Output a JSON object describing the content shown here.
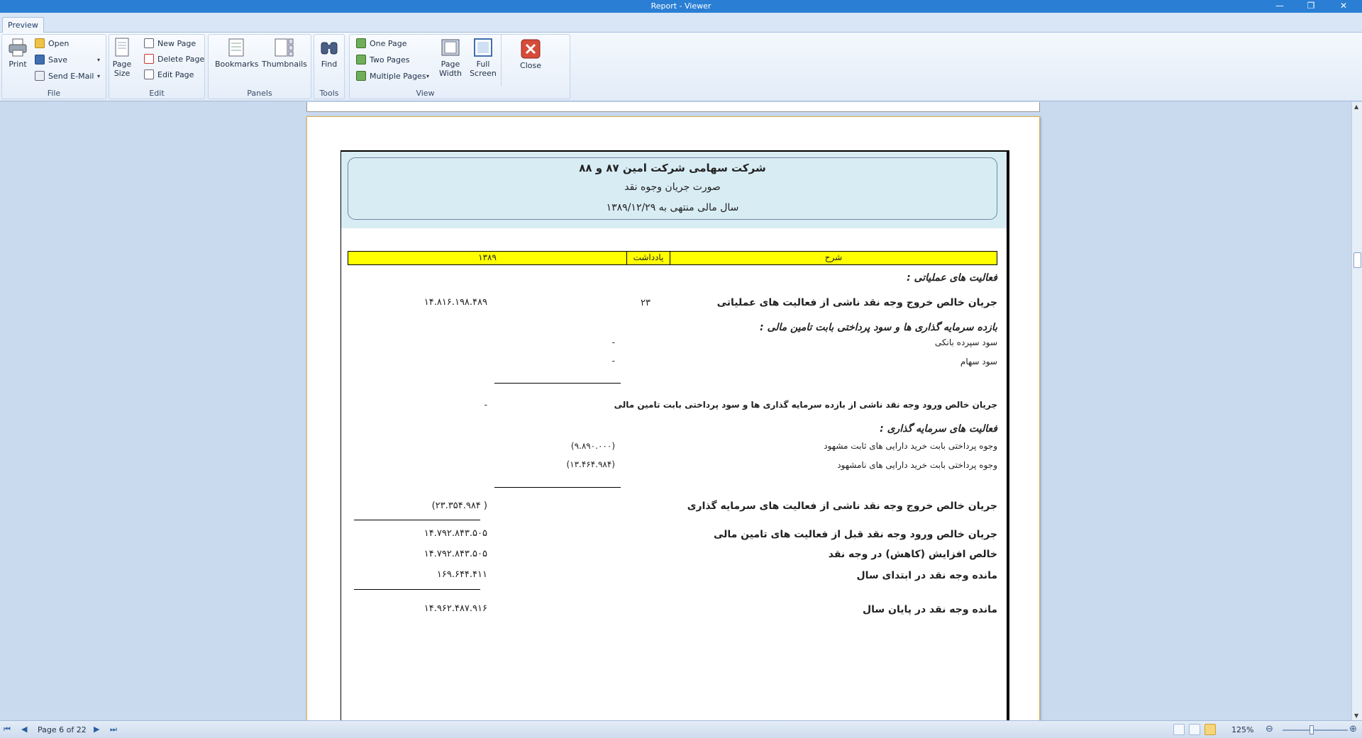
{
  "window": {
    "title": "Report - Viewer",
    "min_glyph": "—",
    "max_glyph": "❐",
    "close_glyph": "✕"
  },
  "tabs": [
    {
      "label": "Preview"
    }
  ],
  "ribbon": {
    "file": {
      "label": "File",
      "print": "Print",
      "open": "Open",
      "save": "Save",
      "send_email": "Send E-Mail"
    },
    "edit": {
      "label": "Edit",
      "page_size_1": "Page",
      "page_size_2": "Size",
      "new_page": "New Page",
      "delete_page": "Delete Page",
      "edit_page": "Edit Page"
    },
    "panels": {
      "label": "Panels",
      "bookmarks": "Bookmarks",
      "thumbnails": "Thumbnails"
    },
    "tools": {
      "label": "Tools",
      "find": "Find"
    },
    "view": {
      "label": "View",
      "one_page": "One Page",
      "two_pages": "Two Pages",
      "multiple_pages": "Multiple Pages",
      "page_width_1": "Page",
      "page_width_2": "Width",
      "full_screen_1": "Full",
      "full_screen_2": "Screen",
      "close": "Close"
    },
    "dropdown_glyph": "▾"
  },
  "report": {
    "company": "شرکت سهامی شرکت امین ۸۷ و ۸۸",
    "statement": "صورت جریان وجوه نقد",
    "period": "سال مالی منتهی به ۱۳۸۹/۱۲/۲۹",
    "columns": {
      "description": "شرح",
      "note": "یادداشت",
      "year": "۱۳۸۹"
    },
    "rows": {
      "operating_heading": "فعالیت های عملیاتی :",
      "operating_net": "جریان خالص خروج وجه نقد ناشی از فعالیت های عملیاتی",
      "operating_note": "۲۳",
      "operating_value": "۱۴.۸۱۶.۱۹۸.۴۸۹",
      "returns_heading": "بازده سرمایه گذاری ها و سود پرداختی بابت تامین مالی :",
      "bank_interest": "سود سپرده بانکی",
      "bank_interest_value": "-",
      "dividends": "سود سهام",
      "dividends_value": "-",
      "returns_net": "جریان خالص ورود وجه نقد ناشی از بازده سرمایه گذاری ها و سود پرداختی بابت تامین مالی",
      "returns_net_value": "-",
      "investing_heading": "فعالیت های سرمایه گذاری :",
      "tangible_assets": "وجوه پرداختی بابت خرید دارایی های ثابت مشهود",
      "tangible_assets_value": "(۹.۸۹۰.۰۰۰)",
      "intangible_assets": "وجوه پرداختی بابت خرید دارایی های نامشهود",
      "intangible_assets_value": "(۱۳.۴۶۴.۹۸۴)",
      "investing_net": "جریان خالص خروج وجه نقد ناشی از فعالیت های سرمایه گذاری",
      "investing_net_value": "(۲۳.۳۵۴.۹۸۴ )",
      "before_financing": "جریان خالص ورود وجه نقد قبل از فعالیت های تامین مالی",
      "before_financing_value": "۱۴.۷۹۲.۸۴۳.۵۰۵",
      "net_change": "خالص افزایش (کاهش) در وجه نقد",
      "net_change_value": "۱۴.۷۹۲.۸۴۳.۵۰۵",
      "opening_cash": "مانده وجه نقد در ابتدای سال",
      "opening_cash_value": "۱۶۹.۶۴۴.۴۱۱",
      "closing_cash": "مانده وجه نقد در پایان سال",
      "closing_cash_value": "۱۴.۹۶۲.۴۸۷.۹۱۶"
    }
  },
  "statusbar": {
    "first": "⏮",
    "prev": "◀",
    "page_info": "Page 6 of 22",
    "next": "▶",
    "last": "⏭",
    "zoom": "125%",
    "zoom_out": "⊖",
    "zoom_in": "⊕"
  },
  "colors": {
    "title_bar": "#2a7fd4",
    "header_band": "#d8ecf4",
    "column_header": "#ffff00",
    "workspace": "#c9d9ee"
  }
}
